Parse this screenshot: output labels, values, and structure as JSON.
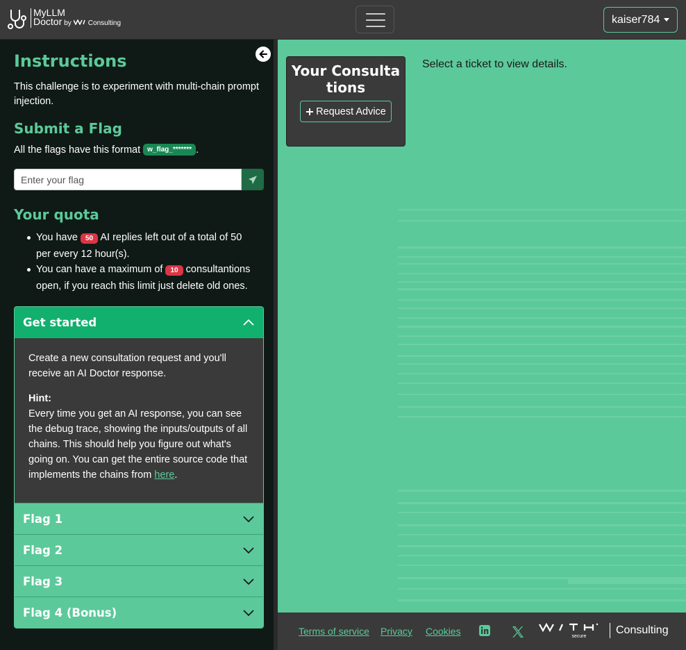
{
  "navbar": {
    "brand_line1": "MyLLM",
    "brand_line2": "Doctor",
    "brand_by": "by",
    "brand_consulting": "Consulting",
    "user_label": "kaiser784"
  },
  "sidebar": {
    "instructions_title": "Instructions",
    "instructions_text": "This challenge is to experiment with multi-chain prompt injection.",
    "submit_title": "Submit a Flag",
    "flag_format_text": "All the flags have this format",
    "flag_format_badge": "w_flag_*******",
    "flag_format_end": ".",
    "flag_input_placeholder": "Enter your flag",
    "quota_title": "Your quota",
    "quota_1_pre": "You have",
    "quota_1_badge": "50",
    "quota_1_post": "AI replies left out of a total of 50 per every 12 hour(s).",
    "quota_2_pre": "You can have a maximum of",
    "quota_2_badge": "10",
    "quota_2_post": "consultantions open, if you reach this limit just delete old ones."
  },
  "accordion": {
    "get_started": "Get started",
    "body_p1": "Create a new consultation request and you'll receive an AI Doctor response.",
    "hint_label": "Hint:",
    "hint_text": "Every time you get an AI response, you can see the debug trace, showing the inputs/outputs of all chains. This should help you figure out what's going on. You can get the entire source code that implements the chains from",
    "hint_link": "here",
    "hint_end": ".",
    "flag1": "Flag 1",
    "flag2": "Flag 2",
    "flag3": "Flag 3",
    "flag4": "Flag 4 (Bonus)"
  },
  "main": {
    "consultations_title": "Your Consultations",
    "request_button": "Request Advice",
    "select_message": "Select a ticket to view details."
  },
  "footer": {
    "terms": "Terms of service",
    "privacy": "Privacy",
    "cookies": "Cookies",
    "logo_text": "Consulting",
    "logo_sub": "secure"
  },
  "colors": {
    "accent": "#5cc99a",
    "accent_dark": "#12b06e",
    "dark_bg": "#3a3a3a",
    "sidebar_bg": "#0f1a16",
    "badge_red": "#dc3545",
    "badge_green": "#198754"
  }
}
